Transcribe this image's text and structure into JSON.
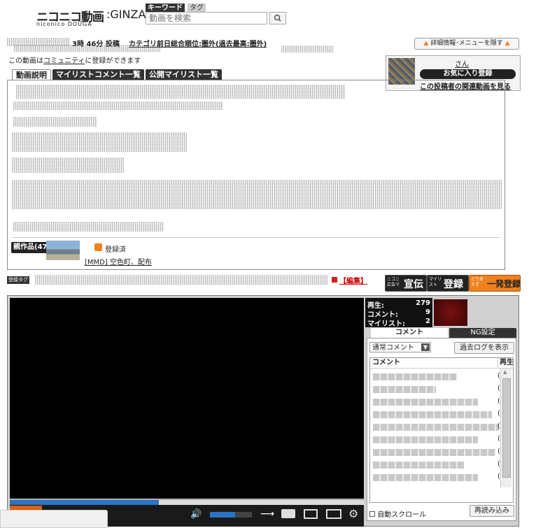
{
  "logo": {
    "text": "ニコニコ動画",
    "suffix": ":GINZA",
    "sub": "niconico DOUGA"
  },
  "search": {
    "tab_keyword": "キーワード",
    "tab_tag": "タグ",
    "placeholder": "動画を検索"
  },
  "info_bar": {
    "posted_time": "3時 46分 投稿",
    "category_rank": "カテゴリ前日総合順位:圏外(過去最高:圏外)",
    "community_prefix": "この動画は",
    "community_link": "コミュニティ",
    "community_suffix": "に登録ができます",
    "hide_button": "詳細情報･メニューを隠す"
  },
  "uploader": {
    "name_suffix": "さん",
    "favorite_button": "お気に入り登録",
    "related_link": "この投稿者の関連動画を見る"
  },
  "desc_tabs": [
    "動画説明",
    "マイリストコメント一覧",
    "公開マイリスト一覧"
  ],
  "related": {
    "new_works_label": "親作品(47)",
    "registered_label": "登録済",
    "work_title": "[MMD] 空色町、配布"
  },
  "tags": {
    "badge": "登録タグ",
    "edit_link": "【編集】"
  },
  "action_buttons": {
    "advertise_small": "ニコニ広告で",
    "advertise": "宣伝",
    "mylist_small": "マイリスト",
    "mylist": "登録",
    "quick_small": "とりあえず",
    "quick": "一発登録"
  },
  "stats": {
    "play_label": "再生:",
    "play_value": "279",
    "comment_label": "コメント:",
    "comment_value": "9",
    "mylist_label": "マイリスト:",
    "mylist_value": "2"
  },
  "panel_tabs": {
    "comment": "コメント",
    "ng": "NG設定"
  },
  "comment_panel": {
    "mode_select": "通常コメント",
    "past_log_button": "過去ログを表示",
    "col_comment": "コメント",
    "col_time": "再生",
    "row_time_prefix": "(",
    "auto_scroll": "自動スクロール",
    "reload_button": "再読み込み"
  },
  "player": {
    "progress": 0.42,
    "volume": 0.6
  },
  "colors": {
    "accent_orange": "#f08020",
    "player_blue": "#2a74c8",
    "edit_red": "#cc0000"
  }
}
